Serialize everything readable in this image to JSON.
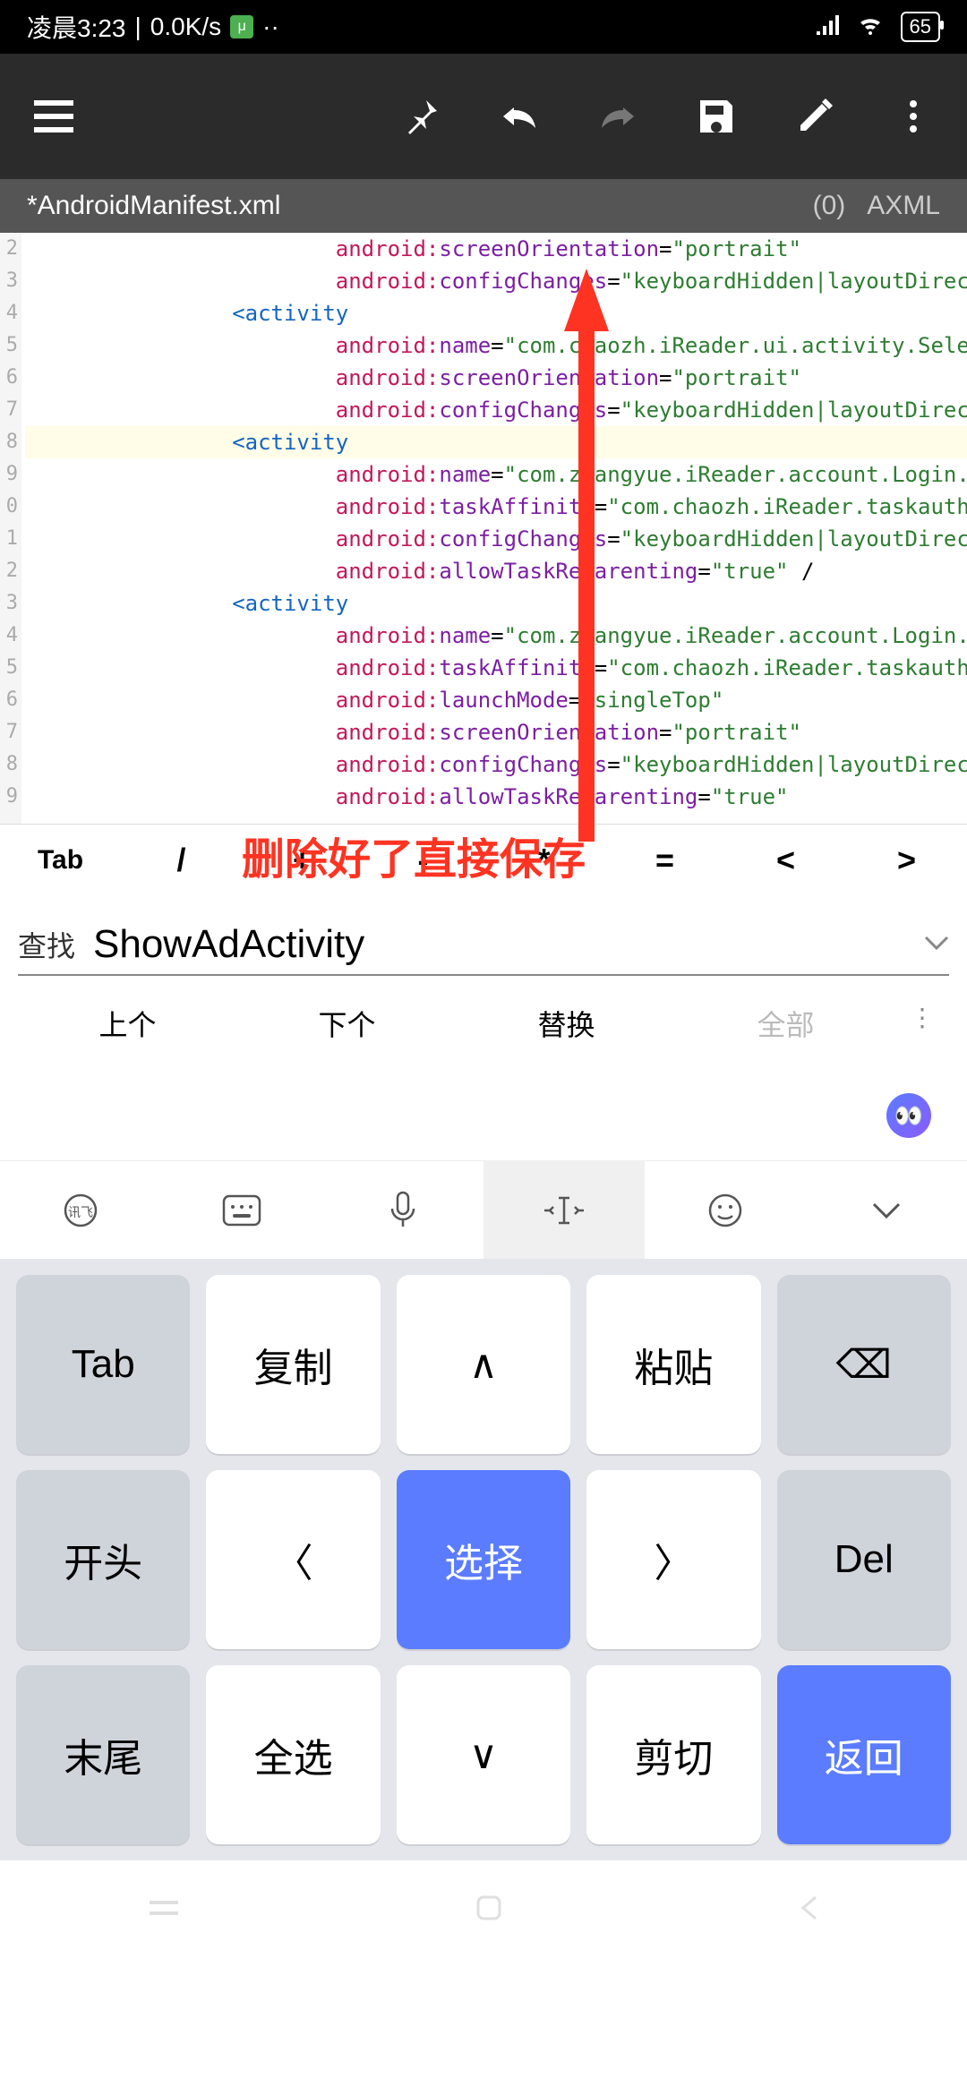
{
  "status": {
    "time": "凌晨3:23",
    "net_speed": "0.0K/s",
    "battery": "65"
  },
  "tabbar": {
    "filename": "*AndroidManifest.xml",
    "count": "(0)",
    "type": "AXML"
  },
  "editor": {
    "gutter": [
      "2",
      "3",
      "4",
      "5",
      "6",
      "7",
      "8",
      "9",
      "0",
      "1",
      "2",
      "3",
      "4",
      "5",
      "6",
      "7",
      "8",
      "9"
    ],
    "lines": [
      {
        "indent": 3,
        "tokens": [
          {
            "t": "attr-ns",
            "v": "android:"
          },
          {
            "t": "attr-name",
            "v": "screenOrientation"
          },
          {
            "t": "",
            "v": "="
          },
          {
            "t": "attr-val",
            "v": "\"portrait\""
          }
        ]
      },
      {
        "indent": 3,
        "tokens": [
          {
            "t": "attr-ns",
            "v": "android:"
          },
          {
            "t": "attr-name",
            "v": "configChanges"
          },
          {
            "t": "",
            "v": "="
          },
          {
            "t": "attr-val",
            "v": "\"keyboardHidden|layoutDirection|navigation|orien"
          }
        ]
      },
      {
        "indent": 2,
        "tokens": [
          {
            "t": "tag",
            "v": "<activity"
          }
        ]
      },
      {
        "indent": 3,
        "tokens": [
          {
            "t": "attr-ns",
            "v": "android:"
          },
          {
            "t": "attr-name",
            "v": "name"
          },
          {
            "t": "",
            "v": "="
          },
          {
            "t": "attr-val",
            "v": "\"com.chaozh.iReader.ui.activity.SelectBook.UpdateUserGu"
          }
        ]
      },
      {
        "indent": 3,
        "tokens": [
          {
            "t": "attr-ns",
            "v": "android:"
          },
          {
            "t": "attr-name",
            "v": "screenOrientation"
          },
          {
            "t": "",
            "v": "="
          },
          {
            "t": "attr-val",
            "v": "\"portrait\""
          }
        ]
      },
      {
        "indent": 3,
        "tokens": [
          {
            "t": "attr-ns",
            "v": "android:"
          },
          {
            "t": "attr-name",
            "v": "configChanges"
          },
          {
            "t": "",
            "v": "="
          },
          {
            "t": "attr-val",
            "v": "\"keyboardHidden|layoutDirection|navigation|orien"
          }
        ]
      },
      {
        "indent": 2,
        "hl": true,
        "tokens": [
          {
            "t": "tag",
            "v": "<activity"
          }
        ]
      },
      {
        "indent": 3,
        "tokens": [
          {
            "t": "attr-ns",
            "v": "android:"
          },
          {
            "t": "attr-name",
            "v": "name"
          },
          {
            "t": "",
            "v": "="
          },
          {
            "t": "attr-val",
            "v": "\"com.zhangyue.iReader.account.Login.ui.AuthorActivity\""
          }
        ]
      },
      {
        "indent": 3,
        "tokens": [
          {
            "t": "attr-ns",
            "v": "android:"
          },
          {
            "t": "attr-name",
            "v": "taskAffinity"
          },
          {
            "t": "",
            "v": "="
          },
          {
            "t": "attr-val",
            "v": "\"com.chaozh.iReader.taskauthor\""
          }
        ]
      },
      {
        "indent": 3,
        "tokens": [
          {
            "t": "attr-ns",
            "v": "android:"
          },
          {
            "t": "attr-name",
            "v": "configChanges"
          },
          {
            "t": "",
            "v": "="
          },
          {
            "t": "attr-val",
            "v": "\"keyboardHidden|layoutDirection|navigation|orien"
          }
        ]
      },
      {
        "indent": 3,
        "tokens": [
          {
            "t": "attr-ns",
            "v": "android:"
          },
          {
            "t": "attr-name",
            "v": "allowTaskReparenting"
          },
          {
            "t": "",
            "v": "="
          },
          {
            "t": "attr-val",
            "v": "\"true\""
          },
          {
            "t": "",
            "v": " /"
          }
        ]
      },
      {
        "indent": 2,
        "tokens": [
          {
            "t": "tag",
            "v": "<activity"
          }
        ]
      },
      {
        "indent": 3,
        "tokens": [
          {
            "t": "attr-ns",
            "v": "android:"
          },
          {
            "t": "attr-name",
            "v": "name"
          },
          {
            "t": "",
            "v": "="
          },
          {
            "t": "attr-val",
            "v": "\"com.zhangyue.iReader.account.Login.ui.LoginActivity\""
          }
        ]
      },
      {
        "indent": 3,
        "tokens": [
          {
            "t": "attr-ns",
            "v": "android:"
          },
          {
            "t": "attr-name",
            "v": "taskAffinity"
          },
          {
            "t": "",
            "v": "="
          },
          {
            "t": "attr-val",
            "v": "\"com.chaozh.iReader.taskauthor\""
          }
        ]
      },
      {
        "indent": 3,
        "tokens": [
          {
            "t": "attr-ns",
            "v": "android:"
          },
          {
            "t": "attr-name",
            "v": "launchMode"
          },
          {
            "t": "",
            "v": "="
          },
          {
            "t": "attr-val",
            "v": "\"singleTop\""
          }
        ]
      },
      {
        "indent": 3,
        "tokens": [
          {
            "t": "attr-ns",
            "v": "android:"
          },
          {
            "t": "attr-name",
            "v": "screenOrientation"
          },
          {
            "t": "",
            "v": "="
          },
          {
            "t": "attr-val",
            "v": "\"portrait\""
          }
        ]
      },
      {
        "indent": 3,
        "tokens": [
          {
            "t": "attr-ns",
            "v": "android:"
          },
          {
            "t": "attr-name",
            "v": "configChanges"
          },
          {
            "t": "",
            "v": "="
          },
          {
            "t": "attr-val",
            "v": "\"keyboardHidden|layoutDirection|navigation|orien"
          }
        ]
      },
      {
        "indent": 3,
        "tokens": [
          {
            "t": "attr-ns",
            "v": "android:"
          },
          {
            "t": "attr-name",
            "v": "allowTaskReparenting"
          },
          {
            "t": "",
            "v": "="
          },
          {
            "t": "attr-val",
            "v": "\"true\""
          }
        ]
      }
    ]
  },
  "symrow": {
    "keys": [
      "Tab",
      "/",
      "+",
      "-",
      "*",
      "=",
      "<",
      ">"
    ]
  },
  "search": {
    "label": "查找",
    "value": "ShowAdActivity",
    "actions": [
      "上个",
      "下个",
      "替换",
      "全部"
    ]
  },
  "keyboard": {
    "keys": [
      {
        "label": "Tab",
        "style": "gray"
      },
      {
        "label": "复制",
        "style": ""
      },
      {
        "label": "∧",
        "style": ""
      },
      {
        "label": "粘贴",
        "style": ""
      },
      {
        "label": "⌫",
        "style": "gray"
      },
      {
        "label": "开头",
        "style": "gray"
      },
      {
        "label": "〈",
        "style": ""
      },
      {
        "label": "选择",
        "style": "blue"
      },
      {
        "label": "〉",
        "style": ""
      },
      {
        "label": "Del",
        "style": "gray"
      },
      {
        "label": "末尾",
        "style": "gray"
      },
      {
        "label": "全选",
        "style": ""
      },
      {
        "label": "∨",
        "style": ""
      },
      {
        "label": "剪切",
        "style": ""
      },
      {
        "label": "返回",
        "style": "blue"
      }
    ]
  },
  "annotation": {
    "text": "删除好了直接保存"
  }
}
